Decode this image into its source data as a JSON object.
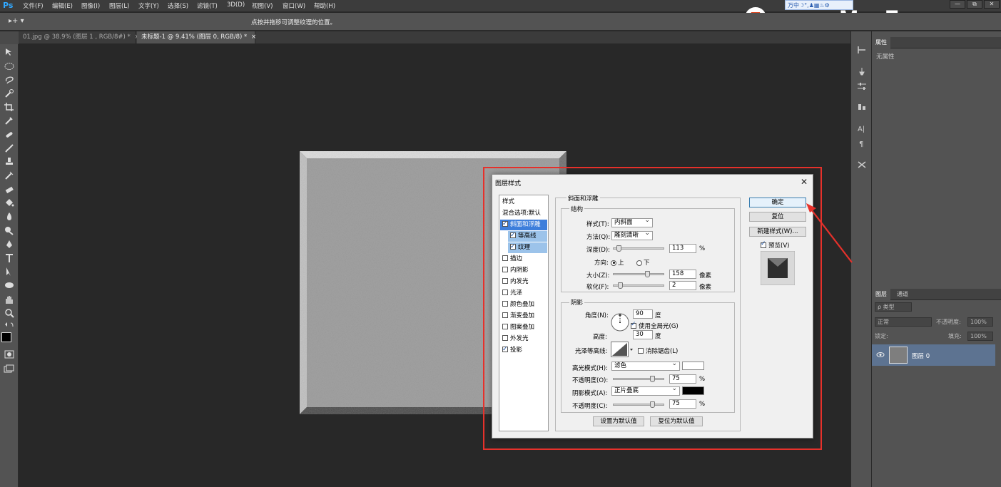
{
  "app": {
    "logo": "Ps"
  },
  "menu": [
    "文件(F)",
    "编辑(E)",
    "图像(I)",
    "图层(L)",
    "文字(Y)",
    "选择(S)",
    "滤镜(T)",
    "3D(D)",
    "视图(V)",
    "窗口(W)",
    "帮助(H)"
  ],
  "watermark": {
    "logo_letter": "Z",
    "text": "www.MacZ.com"
  },
  "ime": {
    "text": "万中☽°,♟▦♨⚙"
  },
  "window_buttons": [
    "—",
    "⧉",
    "✕"
  ],
  "options_bar": {
    "hint": "点按并拖移可调整纹理的位置。",
    "tool": "▸+ ▾"
  },
  "tabs": [
    {
      "label": "01.jpg @ 38.9% (图层 1 , RGB/8#) *",
      "close": "×"
    },
    {
      "label": "未标题-1 @ 9.41% (图层 0, RGB/8) *",
      "close": "×"
    }
  ],
  "properties": {
    "tab_label": "属性",
    "empty_text": "无属性"
  },
  "layers": {
    "tabs": [
      "图层",
      "通道"
    ],
    "filter_kind": "ρ 类型",
    "blend_mode": "正常",
    "opacity_label": "不透明度:",
    "opacity_value": "100%",
    "lock_label": "锁定:",
    "fill_label": "填充:",
    "fill_value": "100%",
    "layer_name": "图层 0"
  },
  "dialog": {
    "title": "图层样式",
    "close": "✕",
    "styles_header": "样式",
    "blend_options": "混合选项:默认",
    "style_items": [
      {
        "label": "斜面和浮雕",
        "checked": true,
        "state": "selected"
      },
      {
        "label": "等高线",
        "checked": true,
        "state": "sub"
      },
      {
        "label": "纹理",
        "checked": true,
        "state": "sub"
      },
      {
        "label": "描边",
        "checked": false,
        "state": ""
      },
      {
        "label": "内阴影",
        "checked": false,
        "state": ""
      },
      {
        "label": "内发光",
        "checked": false,
        "state": ""
      },
      {
        "label": "光泽",
        "checked": false,
        "state": ""
      },
      {
        "label": "颜色叠加",
        "checked": false,
        "state": ""
      },
      {
        "label": "渐变叠加",
        "checked": false,
        "state": ""
      },
      {
        "label": "图案叠加",
        "checked": false,
        "state": ""
      },
      {
        "label": "外发光",
        "checked": false,
        "state": ""
      },
      {
        "label": "投影",
        "checked": true,
        "state": ""
      }
    ],
    "bevel": {
      "section_title": "斜面和浮雕",
      "structure_title": "结构",
      "style_label": "样式(T):",
      "style_value": "内斜面",
      "technique_label": "方法(Q):",
      "technique_value": "雕刻清晰",
      "depth_label": "深度(D):",
      "depth_value": "113",
      "depth_unit": "%",
      "direction_label": "方向:",
      "dir_up": "上",
      "dir_down": "下",
      "size_label": "大小(Z):",
      "size_value": "158",
      "size_unit": "像素",
      "soften_label": "软化(F):",
      "soften_value": "2",
      "soften_unit": "像素"
    },
    "shading": {
      "title": "阴影",
      "angle_label": "角度(N):",
      "angle_value": "90",
      "angle_unit": "度",
      "global_light": "使用全局光(G)",
      "altitude_label": "高度:",
      "altitude_value": "30",
      "altitude_unit": "度",
      "gloss_label": "光泽等高线:",
      "antialias": "消除锯齿(L)",
      "highlight_label": "高光模式(H):",
      "highlight_mode": "滤色",
      "highlight_color": "#ffffff",
      "hl_opacity_label": "不透明度(O):",
      "hl_opacity": "75",
      "shadow_label": "阴影模式(A):",
      "shadow_mode": "正片叠底",
      "shadow_color": "#000000",
      "sh_opacity_label": "不透明度(C):",
      "sh_opacity": "75",
      "pct": "%"
    },
    "make_default": "设置为默认值",
    "reset_default": "复位为默认值",
    "ok": "确定",
    "cancel": "复位",
    "new_style": "新建样式(W)...",
    "preview": "预览(V)"
  },
  "accent": {
    "highlight_red": "#e6312b",
    "selection_blue": "#3d7edb"
  }
}
